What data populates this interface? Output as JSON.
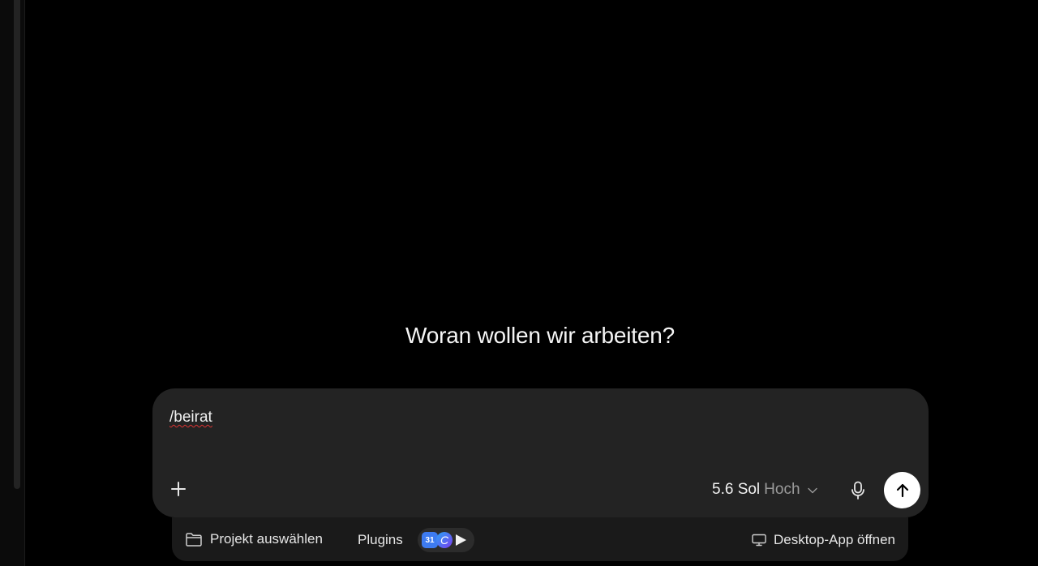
{
  "main": {
    "heading": "Woran wollen wir arbeiten?"
  },
  "composer": {
    "input_value": "/beirat",
    "model_name": "5.6 Sol",
    "model_level": "Hoch"
  },
  "bottom_bar": {
    "project_label": "Projekt auswählen",
    "plugins_label": "Plugins",
    "plugin_calendar_day": "31",
    "plugin_c_letter": "C",
    "desktop_label": "Desktop-App öffnen"
  },
  "icons": {
    "add": "plus-icon",
    "model_dropdown": "chevron-down-icon",
    "mic": "microphone-icon",
    "send": "arrow-up-icon",
    "project": "folder-icon",
    "desktop": "monitor-icon"
  },
  "colors": {
    "background": "#000000",
    "composer": "#232323",
    "bottom_bar": "#1a1a1a",
    "send_button": "#ffffff",
    "spellcheck_underline": "#dd3333"
  }
}
